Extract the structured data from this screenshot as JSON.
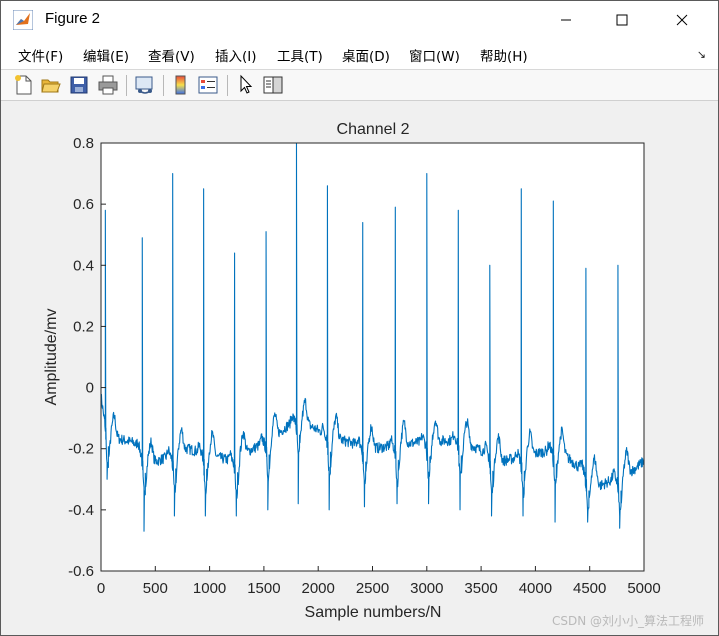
{
  "window": {
    "title": "Figure 2",
    "controls": [
      "minimize",
      "maximize",
      "close"
    ]
  },
  "menubar": {
    "items": [
      {
        "label": "文件(F)"
      },
      {
        "label": "编辑(E)"
      },
      {
        "label": "查看(V)"
      },
      {
        "label": "插入(I)"
      },
      {
        "label": "工具(T)"
      },
      {
        "label": "桌面(D)"
      },
      {
        "label": "窗口(W)"
      },
      {
        "label": "帮助(H)"
      }
    ],
    "overflow_icon": "dock-arrow-icon"
  },
  "toolbar": {
    "buttons": [
      "new-figure-icon",
      "open-icon",
      "save-icon",
      "print-icon",
      "link-plot-icon",
      "colorbar-icon",
      "legend-icon",
      "pointer-icon",
      "property-editor-icon"
    ]
  },
  "chart_data": {
    "type": "line",
    "title": "Channel 2",
    "xlabel": "Sample numbers/N",
    "ylabel": "Amplitude/mv",
    "xlim": [
      0,
      5000
    ],
    "ylim": [
      -0.6,
      0.8
    ],
    "xticks": [
      "0",
      "500",
      "1000",
      "1500",
      "2000",
      "2500",
      "3000",
      "3500",
      "4000",
      "4500",
      "5000"
    ],
    "yticks": [
      "0.8",
      "0.6",
      "0.4",
      "0.2",
      "0",
      "-0.2",
      "-0.4",
      "-0.6"
    ],
    "grid": false,
    "series_color": "#0072BD",
    "beats": [
      {
        "x": 40,
        "peak": 0.58,
        "trough": -0.3
      },
      {
        "x": 380,
        "peak": 0.49,
        "trough": -0.47
      },
      {
        "x": 660,
        "peak": 0.7,
        "trough": -0.42
      },
      {
        "x": 945,
        "peak": 0.65,
        "trough": -0.42
      },
      {
        "x": 1230,
        "peak": 0.44,
        "trough": -0.42
      },
      {
        "x": 1520,
        "peak": 0.51,
        "trough": -0.4
      },
      {
        "x": 1800,
        "peak": 0.8,
        "trough": -0.38
      },
      {
        "x": 2085,
        "peak": 0.66,
        "trough": -0.4
      },
      {
        "x": 2410,
        "peak": 0.54,
        "trough": -0.39
      },
      {
        "x": 2710,
        "peak": 0.59,
        "trough": -0.38
      },
      {
        "x": 3000,
        "peak": 0.7,
        "trough": -0.38
      },
      {
        "x": 3290,
        "peak": 0.58,
        "trough": -0.4
      },
      {
        "x": 3580,
        "peak": 0.4,
        "trough": -0.42
      },
      {
        "x": 3870,
        "peak": 0.65,
        "trough": -0.42
      },
      {
        "x": 4165,
        "peak": 0.61,
        "trough": -0.44
      },
      {
        "x": 4465,
        "peak": 0.39,
        "trough": -0.44
      },
      {
        "x": 4760,
        "peak": 0.4,
        "trough": -0.46
      }
    ],
    "baseline": [
      {
        "x": 0,
        "y": -0.05
      },
      {
        "x": 80,
        "y": -0.16
      },
      {
        "x": 300,
        "y": -0.18
      },
      {
        "x": 450,
        "y": -0.25
      },
      {
        "x": 800,
        "y": -0.2
      },
      {
        "x": 1200,
        "y": -0.24
      },
      {
        "x": 1600,
        "y": -0.16
      },
      {
        "x": 1800,
        "y": -0.1
      },
      {
        "x": 2100,
        "y": -0.16
      },
      {
        "x": 2500,
        "y": -0.2
      },
      {
        "x": 2900,
        "y": -0.18
      },
      {
        "x": 3300,
        "y": -0.17
      },
      {
        "x": 3700,
        "y": -0.24
      },
      {
        "x": 4200,
        "y": -0.2
      },
      {
        "x": 4600,
        "y": -0.32
      },
      {
        "x": 4900,
        "y": -0.27
      },
      {
        "x": 5000,
        "y": -0.24
      }
    ]
  },
  "watermark": "CSDN @刘小小_算法工程师"
}
